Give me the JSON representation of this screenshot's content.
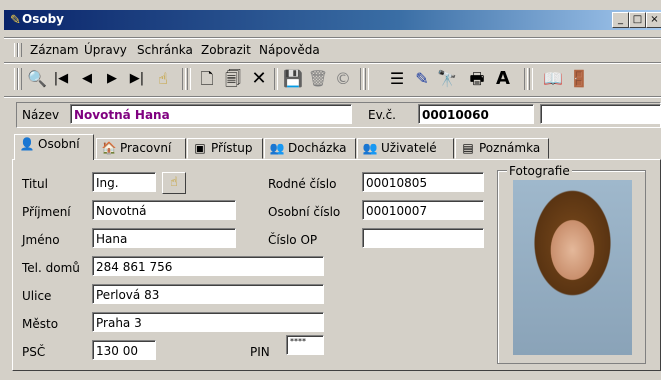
{
  "window": {
    "title": "Osoby",
    "buttons": {
      "minimize": "_",
      "maximize": "□",
      "close": "×"
    }
  },
  "menu": {
    "items": [
      "Záznam",
      "Úpravy",
      "Schránka",
      "Zobrazit",
      "Nápověda"
    ]
  },
  "toolbar": {
    "buttons": [
      {
        "name": "search",
        "glyph": "🔍"
      },
      {
        "name": "first",
        "glyph": "|◀"
      },
      {
        "name": "previous",
        "glyph": "◀"
      },
      {
        "name": "next",
        "glyph": "▶"
      },
      {
        "name": "last",
        "glyph": "▶|"
      },
      {
        "name": "go-to",
        "glyph": "☝"
      },
      {
        "name": "new",
        "glyph": "🗋"
      },
      {
        "name": "copy",
        "glyph": "🗐"
      },
      {
        "name": "delete",
        "glyph": "✕"
      },
      {
        "name": "save",
        "glyph": "💾"
      },
      {
        "name": "cancel",
        "glyph": "🗑"
      },
      {
        "name": "refresh",
        "glyph": "©"
      },
      {
        "name": "list",
        "glyph": "☰"
      },
      {
        "name": "filter",
        "glyph": "✎"
      },
      {
        "name": "find",
        "glyph": "🔭"
      },
      {
        "name": "print",
        "glyph": "🖶"
      },
      {
        "name": "font",
        "glyph": "A"
      },
      {
        "name": "help",
        "glyph": "📖"
      },
      {
        "name": "exit",
        "glyph": "🚪"
      }
    ]
  },
  "header": {
    "name_label": "Název",
    "name_value": "Novotná Hana",
    "evc_label": "Ev.č.",
    "evc_value": "00010060",
    "extra_value": ""
  },
  "tabs": [
    {
      "label": "Osobní",
      "icon": "person-icon",
      "active": true
    },
    {
      "label": "Pracovní",
      "icon": "work-icon",
      "active": false
    },
    {
      "label": "Přístup",
      "icon": "access-icon",
      "active": false
    },
    {
      "label": "Docházka",
      "icon": "attendance-icon",
      "active": false
    },
    {
      "label": "Uživatelé",
      "icon": "users-icon",
      "active": false
    },
    {
      "label": "Poznámka",
      "icon": "note-icon",
      "active": false
    }
  ],
  "form": {
    "titul_label": "Titul",
    "titul_value": "Ing.",
    "prijmeni_label": "Příjmení",
    "prijmeni_value": "Novotná",
    "jmeno_label": "Jméno",
    "jmeno_value": "Hana",
    "tel_label": "Tel. domů",
    "tel_value": "284 861 756",
    "ulice_label": "Ulice",
    "ulice_value": "Perlová 83",
    "mesto_label": "Město",
    "mesto_value": "Praha 3",
    "psc_label": "PSČ",
    "psc_value": "130 00",
    "pin_label": "PIN",
    "pin_value": "****",
    "rodne_label": "Rodné číslo",
    "rodne_value": "00010805",
    "osobni_label": "Osobní číslo",
    "osobni_value": "00010007",
    "op_label": "Číslo OP",
    "op_value": "",
    "foto_label": "Fotografie"
  },
  "colors": {
    "name_value": "#800080",
    "titlebar": "#0a246a"
  }
}
